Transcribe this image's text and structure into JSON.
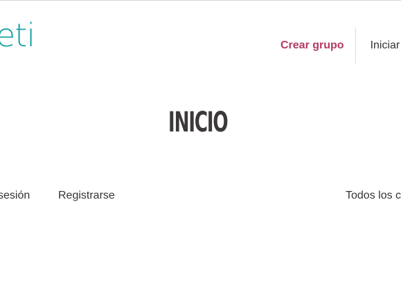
{
  "logo": {
    "text": "eti"
  },
  "header": {
    "create_group_label": "Crear grupo",
    "login_label": "Iniciar"
  },
  "main": {
    "title": "INICIO"
  },
  "subnav": {
    "login_label": "sesión",
    "register_label": "Registrarse",
    "all_label": "Todos los c"
  },
  "colors": {
    "brand_teal": "#1aa1a3",
    "accent_magenta": "#b23a64",
    "title": "#3d393a",
    "text": "#333333"
  }
}
